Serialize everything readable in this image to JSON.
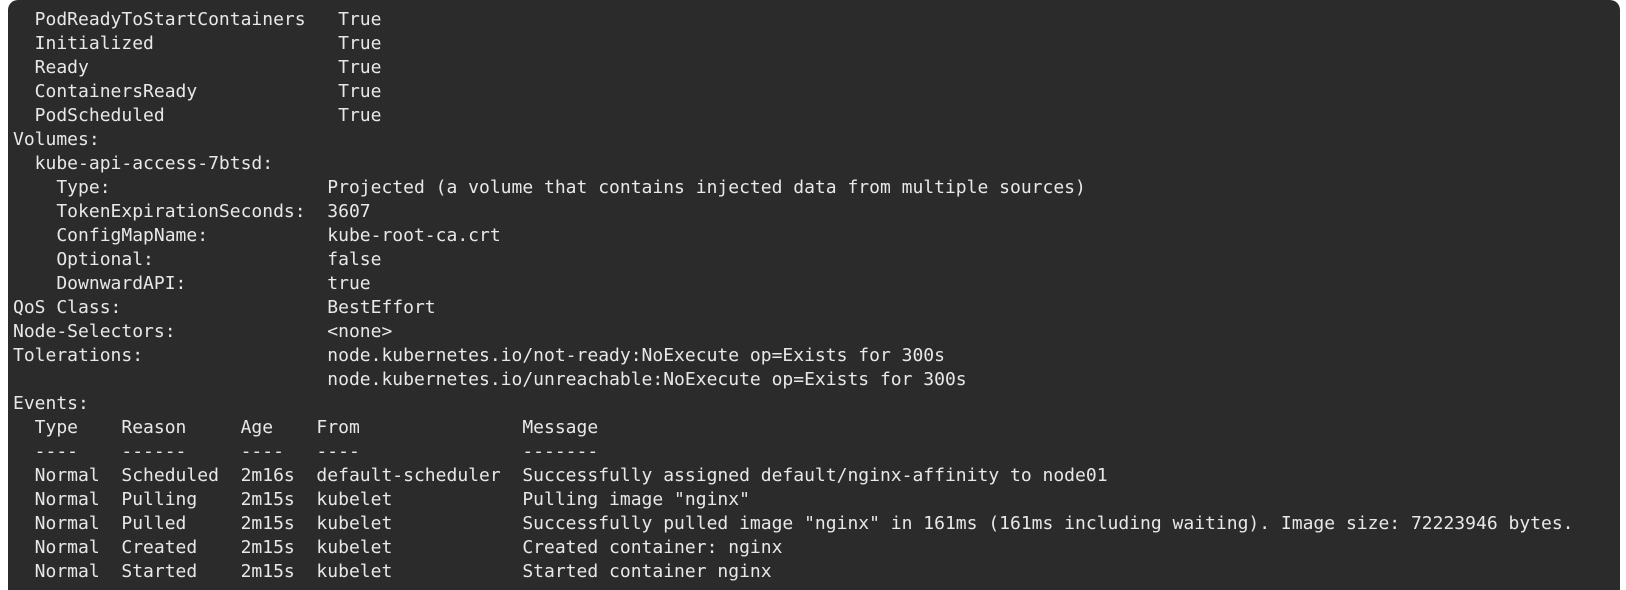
{
  "terminal": {
    "lines": [
      "  PodReadyToStartContainers   True",
      "  Initialized                 True",
      "  Ready                       True",
      "  ContainersReady             True",
      "  PodScheduled                True",
      "Volumes:",
      "  kube-api-access-7btsd:",
      "    Type:                    Projected (a volume that contains injected data from multiple sources)",
      "    TokenExpirationSeconds:  3607",
      "    ConfigMapName:           kube-root-ca.crt",
      "    Optional:                false",
      "    DownwardAPI:             true",
      "QoS Class:                   BestEffort",
      "Node-Selectors:              <none>",
      "Tolerations:                 node.kubernetes.io/not-ready:NoExecute op=Exists for 300s",
      "                             node.kubernetes.io/unreachable:NoExecute op=Exists for 300s",
      "Events:",
      "  Type    Reason     Age    From               Message",
      "  ----    ------     ----   ----               -------",
      "  Normal  Scheduled  2m16s  default-scheduler  Successfully assigned default/nginx-affinity to node01",
      "  Normal  Pulling    2m15s  kubelet            Pulling image \"nginx\"",
      "  Normal  Pulled     2m15s  kubelet            Successfully pulled image \"nginx\" in 161ms (161ms including waiting). Image size: 72223946 bytes.",
      "  Normal  Created    2m15s  kubelet            Created container: nginx",
      "  Normal  Started    2m15s  kubelet            Started container nginx"
    ]
  }
}
